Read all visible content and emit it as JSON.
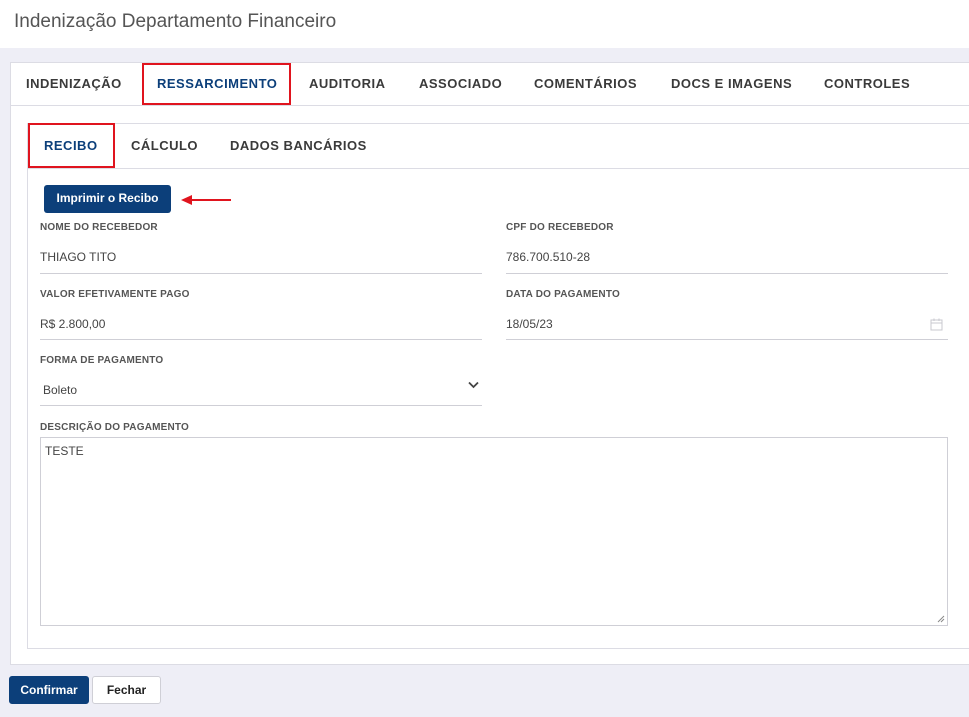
{
  "page": {
    "title": "Indenização Departamento Financeiro"
  },
  "main_tabs": [
    {
      "label": "INDENIZAÇÃO"
    },
    {
      "label": "RESSARCIMENTO"
    },
    {
      "label": "AUDITORIA"
    },
    {
      "label": "ASSOCIADO"
    },
    {
      "label": "COMENTÁRIOS"
    },
    {
      "label": "DOCS E IMAGENS"
    },
    {
      "label": "CONTROLES"
    }
  ],
  "sub_tabs": [
    {
      "label": "RECIBO"
    },
    {
      "label": "CÁLCULO"
    },
    {
      "label": "DADOS BANCÁRIOS"
    }
  ],
  "recibo": {
    "print_button": "Imprimir o Recibo",
    "nome_label": "NOME DO RECEBEDOR",
    "nome_value": "THIAGO TITO",
    "cpf_label": "CPF DO RECEBEDOR",
    "cpf_value": "786.700.510-28",
    "valor_label": "VALOR EFETIVAMENTE PAGO",
    "valor_value": "R$ 2.800,00",
    "data_label": "DATA DO PAGAMENTO",
    "data_value": "18/05/23",
    "forma_label": "FORMA DE PAGAMENTO",
    "forma_value": "Boleto",
    "descricao_label": "DESCRIÇÃO DO PAGAMENTO",
    "descricao_value": "TESTE"
  },
  "footer": {
    "confirm": "Confirmar",
    "close": "Fechar"
  },
  "colors": {
    "accent": "#0c3f7a",
    "highlight": "#e0141e",
    "background": "#eeeef6"
  },
  "icons": {
    "date": "calendar-icon",
    "select": "chevron-down-icon",
    "annotation": "arrow-left-icon"
  }
}
